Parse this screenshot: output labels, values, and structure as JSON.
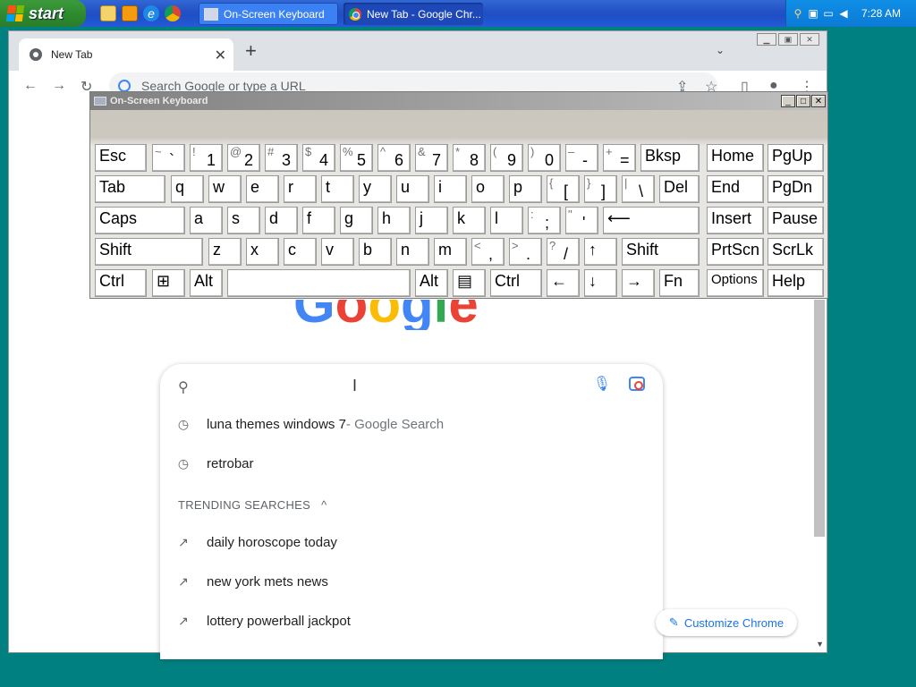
{
  "taskbar": {
    "start_label": "start",
    "tasks": [
      {
        "label": "On-Screen Keyboard"
      },
      {
        "label": "New Tab - Google Chr..."
      }
    ],
    "clock": "7:28 AM"
  },
  "browser": {
    "tab_title": "New Tab",
    "omnibox_placeholder": "Search Google or type a URL",
    "logo_letters": [
      "G",
      "o",
      "o",
      "g",
      "l",
      "e"
    ],
    "logo_colors": [
      "#4285f4",
      "#ea4335",
      "#fbbc05",
      "#4285f4",
      "#34a853",
      "#ea4335"
    ],
    "search": {
      "recent": [
        {
          "text": "luna themes windows 7",
          "suffix": " - Google Search"
        },
        {
          "text": "retrobar",
          "suffix": ""
        }
      ],
      "trending_header": "TRENDING SEARCHES",
      "trending": [
        "daily horoscope today",
        "new york mets news",
        "lottery powerball jackpot"
      ]
    },
    "customize_label": "Customize Chrome"
  },
  "osk": {
    "title": "On-Screen Keyboard",
    "keys": [
      {
        "t": "Esc"
      },
      {
        "s": "~",
        "b": "`"
      },
      {
        "s": "!",
        "b": "1"
      },
      {
        "s": "@",
        "b": "2"
      },
      {
        "s": "#",
        "b": "3"
      },
      {
        "s": "$",
        "b": "4"
      },
      {
        "s": "%",
        "b": "5"
      },
      {
        "s": "^",
        "b": "6"
      },
      {
        "s": "&",
        "b": "7"
      },
      {
        "s": "*",
        "b": "8"
      },
      {
        "s": "(",
        "b": "9"
      },
      {
        "s": ")",
        "b": "0"
      },
      {
        "s": "–",
        "b": "-"
      },
      {
        "s": "+",
        "b": "="
      },
      {
        "t": "Bksp"
      },
      {
        "t": "Home"
      },
      {
        "t": "PgUp"
      },
      {
        "t": "Tab"
      },
      {
        "t": "q"
      },
      {
        "t": "w"
      },
      {
        "t": "e"
      },
      {
        "t": "r"
      },
      {
        "t": "t"
      },
      {
        "t": "y"
      },
      {
        "t": "u"
      },
      {
        "t": "i"
      },
      {
        "t": "o"
      },
      {
        "t": "p"
      },
      {
        "s": "{",
        "b": "["
      },
      {
        "s": "}",
        "b": "]"
      },
      {
        "s": "|",
        "b": "\\"
      },
      {
        "t": "Del"
      },
      {
        "t": "End"
      },
      {
        "t": "PgDn"
      },
      {
        "t": "Caps"
      },
      {
        "t": "a"
      },
      {
        "t": "s"
      },
      {
        "t": "d"
      },
      {
        "t": "f"
      },
      {
        "t": "g"
      },
      {
        "t": "h"
      },
      {
        "t": "j"
      },
      {
        "t": "k"
      },
      {
        "t": "l"
      },
      {
        "s": ":",
        "b": ";"
      },
      {
        "s": "\"",
        "b": "'"
      },
      {
        "t": "⟵"
      },
      {
        "t": "Insert"
      },
      {
        "t": "Pause"
      },
      {
        "t": "Shift"
      },
      {
        "t": "z"
      },
      {
        "t": "x"
      },
      {
        "t": "c"
      },
      {
        "t": "v"
      },
      {
        "t": "b"
      },
      {
        "t": "n"
      },
      {
        "t": "m"
      },
      {
        "s": "<",
        "b": ","
      },
      {
        "s": ">",
        "b": "."
      },
      {
        "s": "?",
        "b": "/"
      },
      {
        "t": "↑"
      },
      {
        "t": "Shift"
      },
      {
        "t": "PrtScn"
      },
      {
        "t": "ScrLk"
      },
      {
        "t": "Ctrl"
      },
      {
        "t": "⊞"
      },
      {
        "t": "Alt"
      },
      {
        "t": ""
      },
      {
        "t": "Alt"
      },
      {
        "t": "▤"
      },
      {
        "t": "Ctrl"
      },
      {
        "t": "←"
      },
      {
        "t": "↓"
      },
      {
        "t": "→"
      },
      {
        "t": "Fn"
      },
      {
        "t": "Options"
      },
      {
        "t": "Help"
      }
    ]
  }
}
